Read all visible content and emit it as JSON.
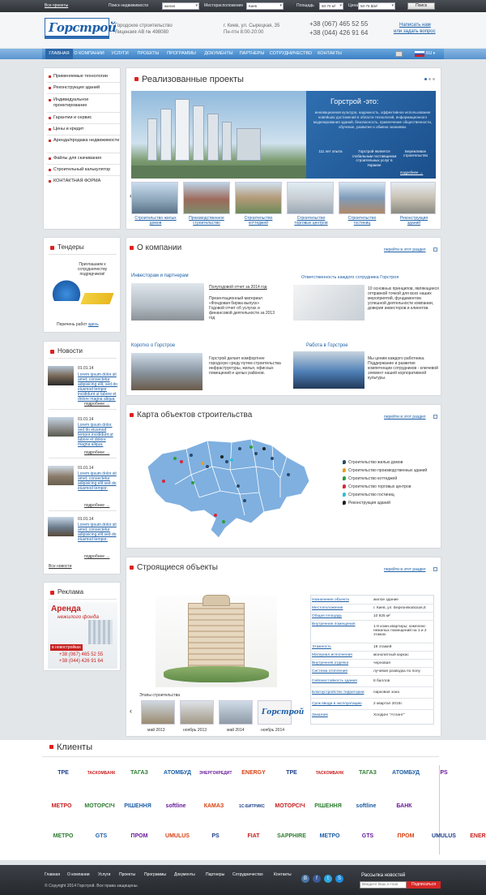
{
  "topbar": {
    "all_projects": "Все проекты",
    "search_label": "Поиск недвижимости",
    "search_value": "жилая",
    "location_label": "Месторасположение",
    "location_value": "Киев",
    "area_label": "Площадь",
    "area_value": "50-70 м²",
    "price_label": "Цена",
    "price_value": "50-75 $/м²",
    "search_button": "Поиск"
  },
  "header": {
    "logo": "Горстрой",
    "company_line1": "Городское строительство",
    "company_line2": "Лицензия АВ № 498080",
    "address_line1": "г. Киев, ул. Сырецкая, 35",
    "address_line2": "Пн-птн   8:00-20:00",
    "phone1": "+38 (067) 465 52 55",
    "phone2": "+38 (044) 426 91 64",
    "write_line1": "Написать нам",
    "write_line2": "или задать вопрос",
    "lang": "RU"
  },
  "nav": [
    "ГЛАВНАЯ",
    "О КОМПАНИИ",
    "УСЛУГИ",
    "ПРОЕКТЫ",
    "ПРОГРАММЫ",
    "ДОКУМЕНТЫ",
    "ПАРТНЕРЫ",
    "СОТРУДНИЧЕСТВО",
    "КОНТАКТЫ"
  ],
  "sidebar": [
    "Применяемые технологии",
    "Реконструкция зданий",
    "Индивидуальное проектирование",
    "Гарантии и сервис",
    "Цены и кредит",
    "Аренда/продажа недвижимости",
    "Файлы для скачивания",
    "Строительный калькулятор",
    "КОНТАКТНАЯ ФОРМА"
  ],
  "projects": {
    "title": "Реализованные проекты",
    "banner_title": "Горстрой -это:",
    "banner_items": [
      "инновационная культура,",
      "надежность,",
      "эффективное использование новейших достижений в области технологий,",
      "информационного моделирования зданий,",
      "безопасность,",
      "привлечение общественности,",
      "обучение,",
      "развитие и",
      "обмена знаниями."
    ],
    "stat1": "111 лет опыта",
    "stat2": "Горстрой является глобальным поставщиком строительных услуг в Украине",
    "stat3": "Бережливое строительство",
    "banner_more": "подробнее →",
    "thumbs": [
      "Строительство жилых домов",
      "Производственное строительство",
      "Строительство коттеджей",
      "Строительство торговых центров",
      "Строительство гостиниц",
      "Реконструкция зданий"
    ]
  },
  "tenders": {
    "title": "Тендеры",
    "text": "Приглашаем к сотрудничеству подрядчиков!",
    "list_prefix": "Перечень работ",
    "list_link": "здесь"
  },
  "news": {
    "title": "Новости",
    "items": [
      {
        "date": "01.01.14",
        "text": "Lorem ipsum dolor sit amet, consectetur adipisicing elit, sed do eiusmod tempor incididunt ut labore et dolore magna aliqua.",
        "more": "подробнее →"
      },
      {
        "date": "01.01.14",
        "text": "Lorem ipsum dolor. sed do eiusmod tempor incididunt ut labore et dolore magna aliqua.",
        "more": "подробнее →"
      },
      {
        "date": "01.01.14",
        "text": "Lorem ipsum dolor sit amet, consectetur adipisicing elit sed do eiusmod tempor.",
        "more": "подробнее →"
      },
      {
        "date": "01.01.14",
        "text": "Lorem ipsum dolor sit amet, consectetur adipisicing elit sed do eiusmod tempor.",
        "more": "подробнее →"
      }
    ],
    "all": "Все новости"
  },
  "ads": {
    "title": "Реклама",
    "line1": "Аренда",
    "line2": "нежилого фонда",
    "line3": "в новостройках",
    "phone1": "+38 (067) 465 52 55",
    "phone2": "+38 (044) 426 91 64"
  },
  "about": {
    "title": "О компании",
    "goto": "перейти в этот раздел",
    "blocks": [
      {
        "head": "Инвесторам и партнерам",
        "link": "Полугодовой отчет за 2014 год",
        "text": "Презентационный материал «Фондовая биржа выпуск» Годовой отчет об услугах и финансовой деятельности за 2013 год"
      },
      {
        "head": "Ответственность каждого сотрудника Горстроя",
        "text": "10 основных принципов, являющиеся отправной точкой для всех наших мероприятий, фундаментом успешной деятельности компании, доверия инвесторов и клиентов."
      },
      {
        "head": "Коротко о Горстрое",
        "text": "Горстрой делает комфортнее городскую среду путем строительства инфраструктуры, жилья, офисных помещений и целых районов."
      },
      {
        "head": "Работа в Горстрое",
        "text": "Мы ценим каждого работника. Поддержание и развитие компетенции сотрудников - ключевой элемент нашей корпоративной культуры."
      }
    ]
  },
  "map": {
    "title": "Карта объектов строительства",
    "goto": "перейти в этот раздел",
    "legend": [
      {
        "label": "Строительство жилых домов",
        "color": "#2a4a6b"
      },
      {
        "label": "Строительство производственных зданий",
        "color": "#e6a020"
      },
      {
        "label": "Строительство коттеджей",
        "color": "#2e9c3a"
      },
      {
        "label": "Строительство торговых центров",
        "color": "#d8263a"
      },
      {
        "label": "Строительство гостиниц",
        "color": "#2ec0d8"
      },
      {
        "label": "Реконструкция зданий",
        "color": "#222222"
      }
    ]
  },
  "building": {
    "title": "Строящиеся объекты",
    "goto": "перейти в этот раздел",
    "stages_label": "Этапы строительства",
    "stages": [
      "май 2013",
      "ноябрь 2013",
      "май 2014",
      "ноябрь 2014"
    ],
    "specs": [
      {
        "k": "Назначение объекта",
        "v": "жилое здание"
      },
      {
        "k": "Местоположение",
        "v": "г. Киев, ул. Березняковская,6"
      },
      {
        "k": "Общая площадь",
        "v": "10 925 м²"
      },
      {
        "k": "Внутренние помещения",
        "v": "1-8 комн.квартиры; комплекс нежилых помещений на 1 и 2 этажах"
      },
      {
        "k": "Этажность",
        "v": "18 этажей"
      },
      {
        "k": "Материал исполнения",
        "v": "монолитный каркас"
      },
      {
        "k": "Внутренняя отделка",
        "v": "черновая"
      },
      {
        "k": "Система отопления",
        "v": "лучевая разводка по полу"
      },
      {
        "k": "Сейсмостойкость здания",
        "v": "8 баллов"
      },
      {
        "k": "Благоустройство территории",
        "v": "парковая зона"
      },
      {
        "k": "Срок ввода в эксплуатацию",
        "v": "2 квартал  2015г."
      },
      {
        "k": "Заказчик",
        "v": "Холдинг \"Атлант\""
      }
    ]
  },
  "clients": {
    "title": "Клиенты",
    "row1": [
      "TPE",
      "ТАСКОМБАНК",
      "ТАГАЗ",
      "АТОМБУД",
      "ЭНЕРГОКРЕДИТ",
      "ENERGY",
      "TPE",
      "ТАСКОМБАНК",
      "ТАГАЗ",
      "АТОМБУД",
      "PS"
    ],
    "row2": [
      "МЕТРО",
      "МОТОРСІЧ",
      "РІШЕННЯ",
      "softline",
      "КАМАЗ",
      "1С-БИТРИКС",
      "МОТОРСІЧ",
      "РІШЕННЯ",
      "softline",
      "БАНК"
    ],
    "row3": [
      "МЕТРО",
      "GTS",
      "ПРОМ",
      "UMULUS",
      "PS",
      "FIAT",
      "SAPPHIRE",
      "МЕТРО",
      "GTS",
      "ПРОМ",
      "UMULUS",
      "ENERGY"
    ]
  },
  "footer": {
    "links": [
      "Главная",
      "О компании",
      "Услуги",
      "Проекты",
      "Программы",
      "Документы",
      "Партнеры",
      "Сотрудничество",
      "Контакты"
    ],
    "copyright": "© Copyright 2014 Горстрой. Все права защищены.",
    "newsletter": "Рассылка новостей",
    "email_placeholder": "Введите Ваш e-mail",
    "subscribe": "Подписаться"
  }
}
